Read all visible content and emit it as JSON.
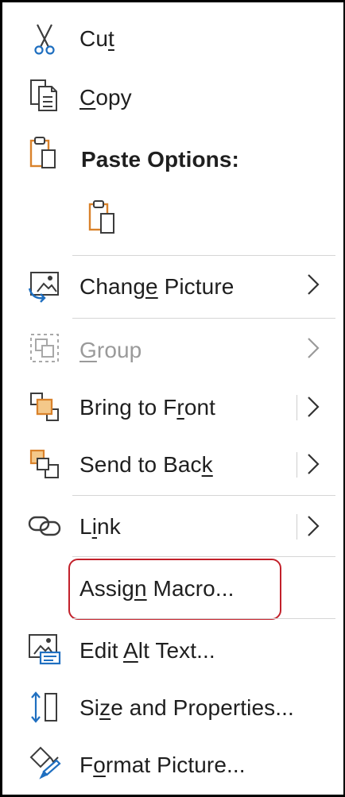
{
  "menu": {
    "cut": {
      "pre": "Cu",
      "acc": "t",
      "post": ""
    },
    "copy": {
      "pre": "",
      "acc": "C",
      "post": "opy"
    },
    "paste_options": {
      "label": "Paste Options:"
    },
    "change_picture": {
      "pre": "Chang",
      "acc": "e",
      "post": " Picture"
    },
    "group": {
      "pre": "",
      "acc": "G",
      "post": "roup"
    },
    "bring_to_front": {
      "pre": "Bring to F",
      "acc": "r",
      "post": "ont"
    },
    "send_to_back": {
      "pre": "Send to Bac",
      "acc": "k",
      "post": ""
    },
    "link": {
      "pre": "L",
      "acc": "i",
      "post": "nk"
    },
    "assign_macro": {
      "pre": "Assig",
      "acc": "n",
      "post": " Macro..."
    },
    "edit_alt_text": {
      "pre": "Edit ",
      "acc": "A",
      "post": "lt Text..."
    },
    "size_and_properties": {
      "pre": "Si",
      "acc": "z",
      "post": "e and Properties..."
    },
    "format_picture": {
      "pre": "F",
      "acc": "o",
      "post": "rmat Picture..."
    }
  },
  "colors": {
    "accent_orange": "#d9822b",
    "accent_blue": "#1f6fc0",
    "highlight_red": "#c2202a"
  }
}
